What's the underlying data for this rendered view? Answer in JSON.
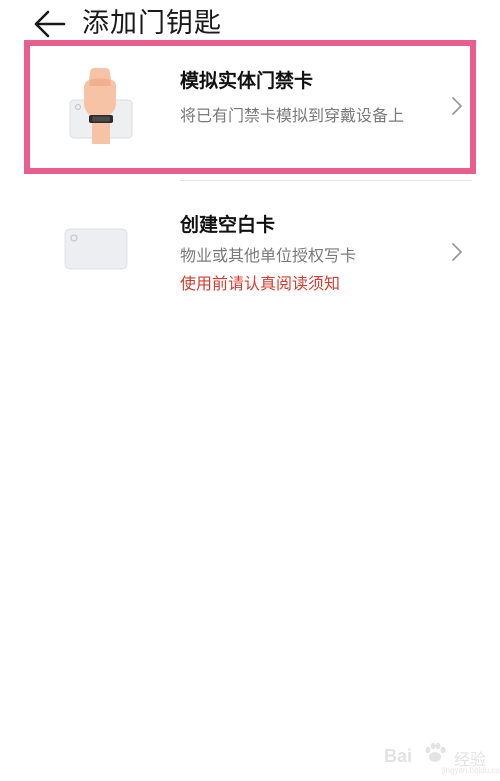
{
  "header": {
    "back_icon": "arrow-left-icon",
    "title": "添加门钥匙"
  },
  "items": [
    {
      "title": "模拟实体门禁卡",
      "description": "将已有门禁卡模拟到穿戴设备上",
      "icon": "wrist-card-icon",
      "highlighted": true,
      "highlight_color": "#ea5e8e"
    },
    {
      "title": "创建空白卡",
      "description": "物业或其他单位授权写卡",
      "warning": "使用前请认真阅读须知",
      "warning_color": "#d43c2f",
      "icon": "blank-card-icon"
    }
  ],
  "watermark": {
    "brand": "Bai",
    "text": "经验",
    "url": "jingyan.baidu.com"
  }
}
